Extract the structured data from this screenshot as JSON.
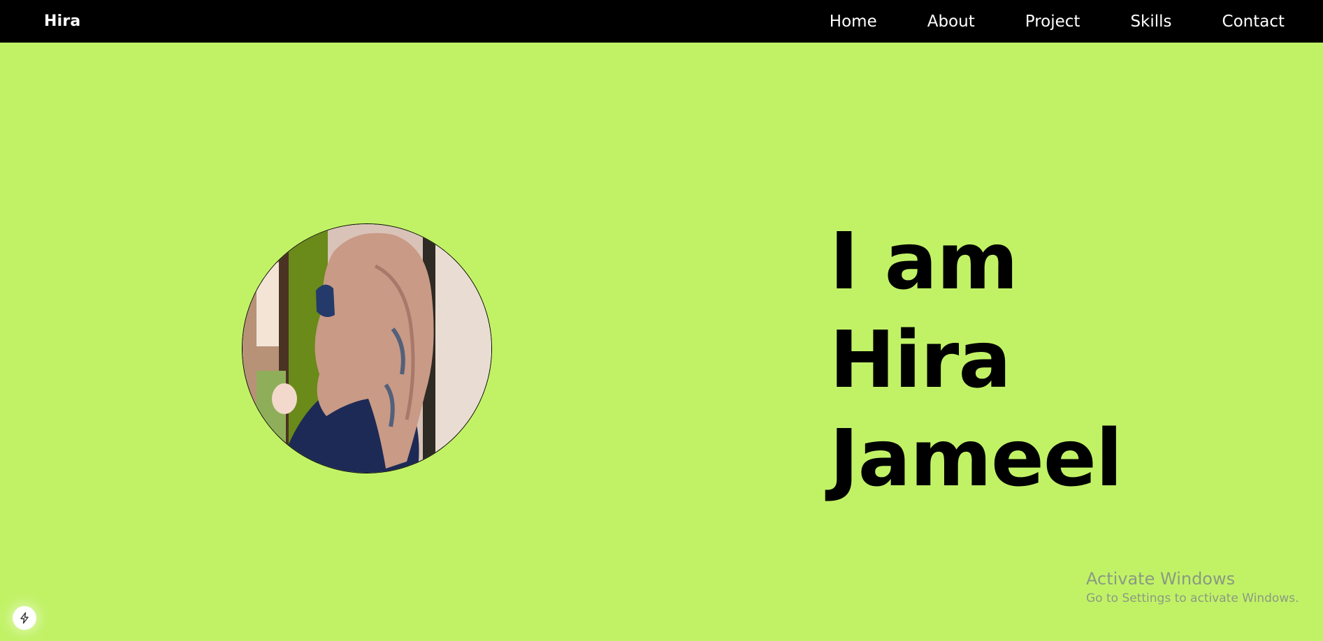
{
  "navbar": {
    "brand": "Hira",
    "links": [
      "Home",
      "About",
      "Project",
      "Skills",
      "Contact"
    ]
  },
  "hero": {
    "line1": "I am",
    "line2": "Hira",
    "line3": "Jameel"
  },
  "watermark": {
    "title": "Activate Windows",
    "subtitle": "Go to Settings to activate Windows."
  },
  "icons": {
    "badge": "lightning-bolt-icon"
  },
  "colors": {
    "background": "#c1f266",
    "navbar": "#000000",
    "nav_text": "#ffffff",
    "heading": "#000000"
  }
}
